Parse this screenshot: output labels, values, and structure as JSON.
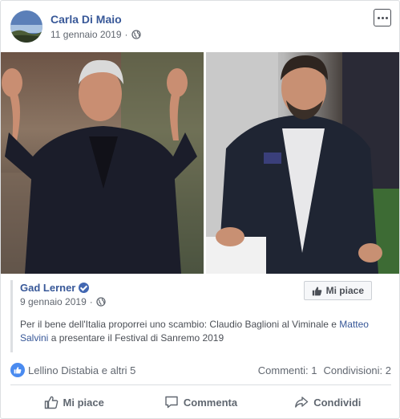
{
  "post": {
    "author": "Carla Di Maio",
    "date": "11 gennaio 2019",
    "separator": "·"
  },
  "shared": {
    "author": "Gad Lerner",
    "date": "9 gennaio 2019",
    "separator": "·",
    "like_page_label": "Mi piace",
    "text_before": "Per il bene dell'Italia proporrei uno scambio: Claudio Baglioni al Viminale e ",
    "mention": "Matteo Salvini",
    "text_after": " a presentare il Festival di Sanremo 2019"
  },
  "reactions": {
    "likers": "Lellino Distabia e altri 5",
    "comments": "Commenti: 1",
    "shares": "Condivisioni: 2"
  },
  "actions": {
    "like": "Mi piace",
    "comment": "Commenta",
    "share": "Condividi"
  },
  "icons": {
    "globe": "globe-icon",
    "verified": "verified-badge-icon",
    "more": "more-options-icon",
    "thumbs_up": "thumbs-up-icon",
    "comment": "comment-bubble-icon",
    "share": "share-arrow-icon"
  },
  "colors": {
    "link": "#385898",
    "like_blue": "#4a8bf0",
    "text_secondary": "#616770"
  }
}
